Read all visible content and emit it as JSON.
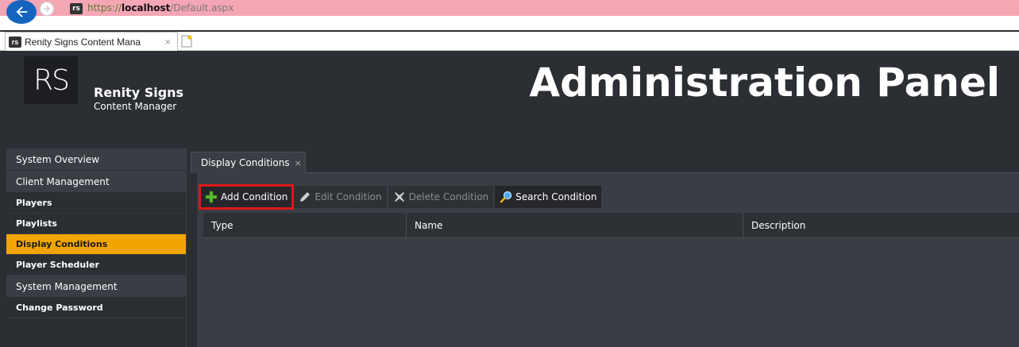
{
  "browser": {
    "url_scheme": "https://",
    "url_host": "localhost",
    "url_path": "/Default.aspx",
    "site_icon": "rs",
    "tab_title": "Renity Signs Content Mana",
    "tab_close": "×"
  },
  "header": {
    "logo": "RS",
    "brand_name": "Renity Signs",
    "brand_sub": "Content Manager",
    "panel_title": "Administration Panel"
  },
  "sidebar": {
    "items": [
      {
        "label": "System Overview",
        "kind": "section"
      },
      {
        "label": "Client Management",
        "kind": "section"
      },
      {
        "label": "Players",
        "kind": "item"
      },
      {
        "label": "Playlists",
        "kind": "item"
      },
      {
        "label": "Display Conditions",
        "kind": "item",
        "active": true
      },
      {
        "label": "Player Scheduler",
        "kind": "item"
      },
      {
        "label": "System Management",
        "kind": "section"
      },
      {
        "label": "Change Password",
        "kind": "item"
      }
    ]
  },
  "main": {
    "tab_label": "Display Conditions",
    "tab_close": "×",
    "toolbar": {
      "add": "Add Condition",
      "edit": "Edit Condition",
      "delete": "Delete Condition",
      "search": "Search Condition"
    },
    "columns": [
      "Type",
      "Name",
      "Description"
    ]
  },
  "colors": {
    "accent": "#f0a500",
    "highlight": "#e0161c",
    "background": "#2b2e33"
  }
}
